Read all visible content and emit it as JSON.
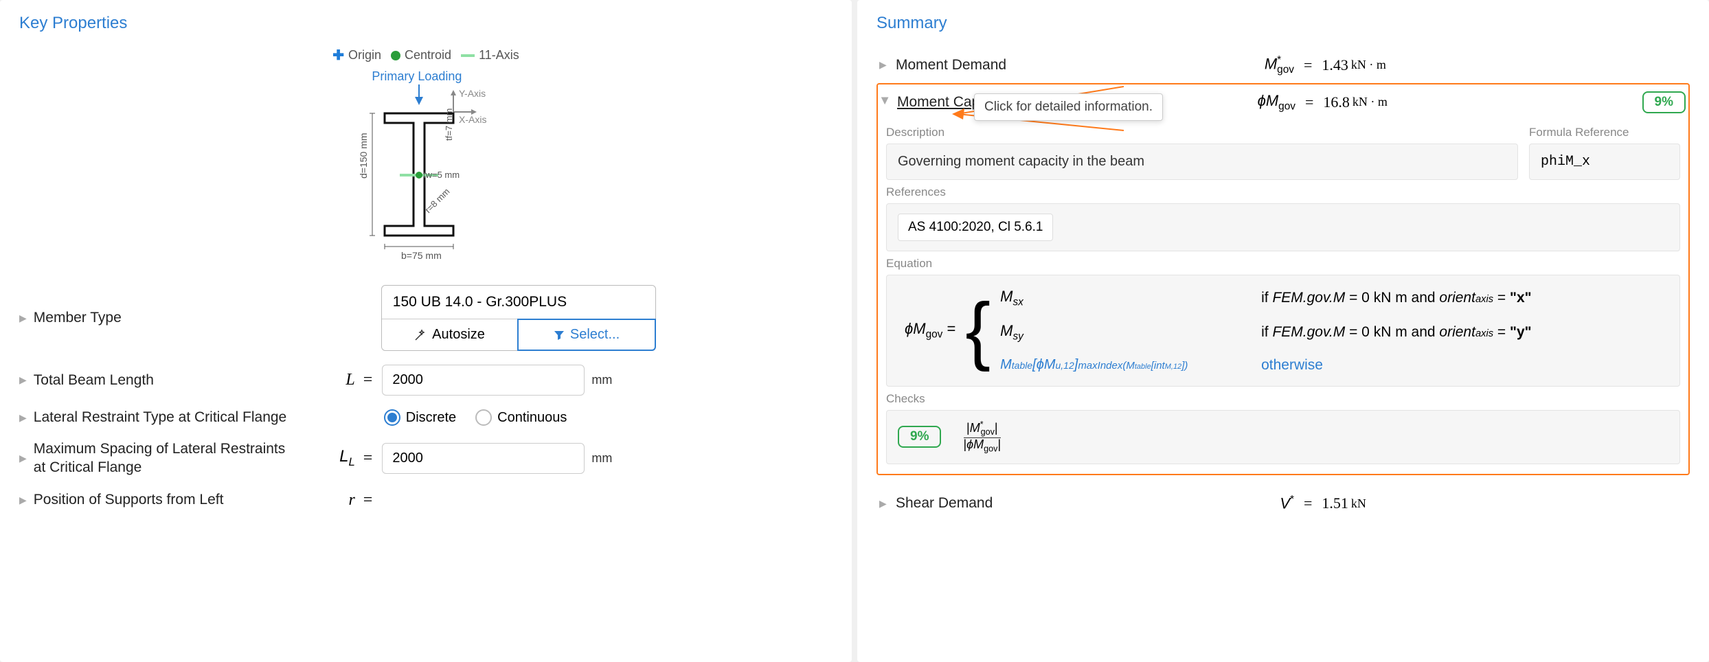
{
  "left": {
    "title": "Key Properties",
    "legend": {
      "origin": "Origin",
      "centroid": "Centroid",
      "axis11": "11-Axis"
    },
    "diagram": {
      "primary_loading": "Primary Loading",
      "yaxis": "Y-Axis",
      "xaxis": "X-Axis",
      "d": "d=150 mm",
      "b": "b=75 mm",
      "tf": "tf=7 mm",
      "tw": "tw=5 mm",
      "r": "r=8 mm"
    },
    "rows": {
      "member_type": {
        "label": "Member Type",
        "value": "150 UB 14.0 - Gr.300PLUS",
        "autosize": "Autosize",
        "select": "Select..."
      },
      "total_length": {
        "label": "Total Beam Length",
        "symbol": "L",
        "value": "2000",
        "unit": "mm"
      },
      "restraint_type": {
        "label": "Lateral Restraint Type at Critical Flange",
        "opt1": "Discrete",
        "opt2": "Continuous"
      },
      "max_spacing": {
        "label": "Maximum Spacing of Lateral Restraints at Critical Flange",
        "symbol": "L",
        "symbol_sub": "L",
        "value": "2000",
        "unit": "mm"
      },
      "supports_pos": {
        "label": "Position of Supports from Left",
        "symbol": "r"
      }
    }
  },
  "right": {
    "title": "Summary",
    "tooltip": "Click for detailed information.",
    "moment_demand": {
      "label": "Moment Demand",
      "sym_pre": "M",
      "sym_sup": "*",
      "sym_sub": "gov",
      "value": "1.43",
      "unit": "kN · m"
    },
    "moment_capacity": {
      "label": "Moment Capacity",
      "sym_pre": "ϕM",
      "sym_sub": "gov",
      "value": "16.8",
      "unit": "kN · m",
      "badge": "9%",
      "description_label": "Description",
      "description": "Governing moment capacity in the beam",
      "formula_ref_label": "Formula Reference",
      "formula_ref": "phiM_x",
      "references_label": "References",
      "reference_chip": "AS 4100:2020, Cl 5.6.1",
      "equation_label": "Equation",
      "eq_lhs": "ϕM",
      "eq_lhs_sub": "gov",
      "case1_lhs": "M",
      "case1_lhs_sub": "sx",
      "case1_rhs": "if FEM.gov.M = 0 kN m and orientₐₓᵢₛ = \"x\"",
      "case2_lhs": "M",
      "case2_lhs_sub": "sy",
      "case2_rhs": "if FEM.gov.M = 0 kN m and orientₐₓᵢₛ = \"y\"",
      "case3_lhs": "Mₜₐᵦₗₑ[ϕMᵤ,₁₂]maxIndex(Mₜₐᵦₗₑ[intM,₁₂])",
      "case3_rhs": "otherwise",
      "checks_label": "Checks",
      "checks_badge": "9%",
      "checks_frac_top": "|M*gov|",
      "checks_frac_bot": "|ϕMgov|"
    },
    "shear_demand": {
      "label": "Shear Demand",
      "sym_pre": "V",
      "sym_sup": "*",
      "value": "1.51",
      "unit": "kN"
    }
  }
}
